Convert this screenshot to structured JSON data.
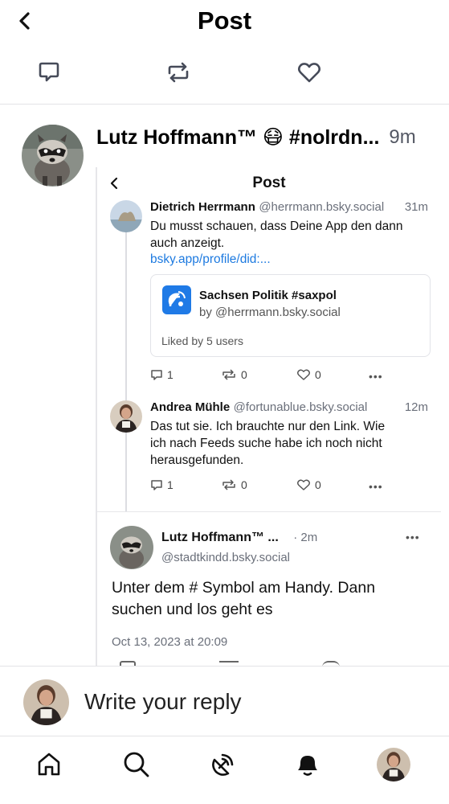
{
  "header": {
    "title": "Post"
  },
  "post": {
    "author": "Lutz Hoffmann™ 😷 #nolrdn...",
    "time": "9m"
  },
  "screenshot": {
    "title": "Post",
    "reply1": {
      "name": "Dietrich Herrmann",
      "handle": "@herrmann.bsky.social",
      "time": "31m",
      "text_line1": "Du musst schauen, dass Deine App den dann",
      "text_line2": "auch anzeigt.",
      "link": "bsky.app/profile/did:...",
      "card": {
        "title": "Sachsen Politik #saxpol",
        "by": "by @herrmann.bsky.social",
        "liked": "Liked by 5 users"
      },
      "replies": "1",
      "reposts": "0",
      "likes": "0"
    },
    "reply2": {
      "name": "Andrea Mühle",
      "handle": "@fortunablue.bsky.social",
      "time": "12m",
      "text_line1": "Das tut sie. Ich brauchte nur den Link. Wie",
      "text_line2": "ich nach Feeds suche habe ich noch nicht",
      "text_line3": "herausgefunden.",
      "replies": "1",
      "reposts": "0",
      "likes": "0"
    },
    "focus": {
      "name": "Lutz Hoffmann™ ...",
      "time": "· 2m",
      "handle": "@stadtkindd.bsky.social",
      "text_line1": "Unter dem # Symbol am Handy. Dann",
      "text_line2": "suchen und los geht es",
      "date": "Oct 13, 2023 at 20:09"
    }
  },
  "reply_bar": {
    "placeholder": "Write your reply"
  },
  "colors": {
    "accent": "#1f7ae6",
    "muted": "#545864",
    "divider": "#e3e3e6"
  },
  "icons": {
    "back": "chevron-left-icon",
    "reply": "speech-bubble-icon",
    "repost": "repost-arrows-icon",
    "like": "heart-icon",
    "home": "home-icon",
    "search": "search-icon",
    "feeds": "satellite-dish-icon",
    "notifications": "bell-icon",
    "profile": "avatar"
  }
}
